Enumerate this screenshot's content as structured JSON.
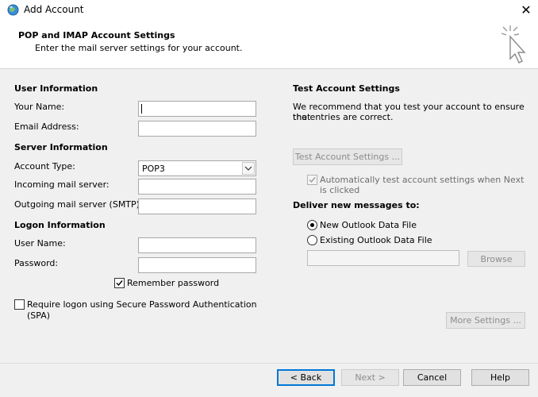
{
  "window": {
    "title": "Add Account",
    "close_label": "✕"
  },
  "header": {
    "title": "POP and IMAP Account Settings",
    "subtitle": "Enter the mail server settings for your account.",
    "icon": "cursor-click-icon"
  },
  "user_information": {
    "section_label": "User Information",
    "your_name_label": "Your Name:",
    "your_name_value": "",
    "email_label": "Email Address:",
    "email_value": ""
  },
  "server_information": {
    "section_label": "Server Information",
    "account_type_label": "Account Type:",
    "account_type_value": "POP3",
    "incoming_label": "Incoming mail server:",
    "incoming_value": "",
    "outgoing_label": "Outgoing mail server (SMTP):",
    "outgoing_value": ""
  },
  "logon_information": {
    "section_label": "Logon Information",
    "username_label": "User Name:",
    "username_value": "",
    "password_label": "Password:",
    "password_value": "",
    "remember_label": "Remember password",
    "remember_checked": true,
    "spa_label_line1": "Require logon using Secure Password Authentication",
    "spa_label_line2": "(SPA)",
    "spa_checked": false
  },
  "test_settings": {
    "section_label": "Test Account Settings",
    "desc_line1": "We recommend that you test your account to ensure that",
    "desc_line2": "the entries are correct.",
    "test_button": "Test Account Settings ...",
    "auto_test_line1": "Automatically test account settings when Next",
    "auto_test_line2": "is clicked",
    "auto_test_checked": true
  },
  "deliver": {
    "section_label": "Deliver new messages to:",
    "new_file_label": "New Outlook Data File",
    "existing_file_label": "Existing Outlook Data File",
    "selected": "new",
    "existing_path": "",
    "browse_button": "Browse"
  },
  "more_settings_button": "More Settings ...",
  "footer": {
    "back_button": "< Back",
    "next_button": "Next >",
    "cancel_button": "Cancel",
    "help_button": "Help"
  }
}
